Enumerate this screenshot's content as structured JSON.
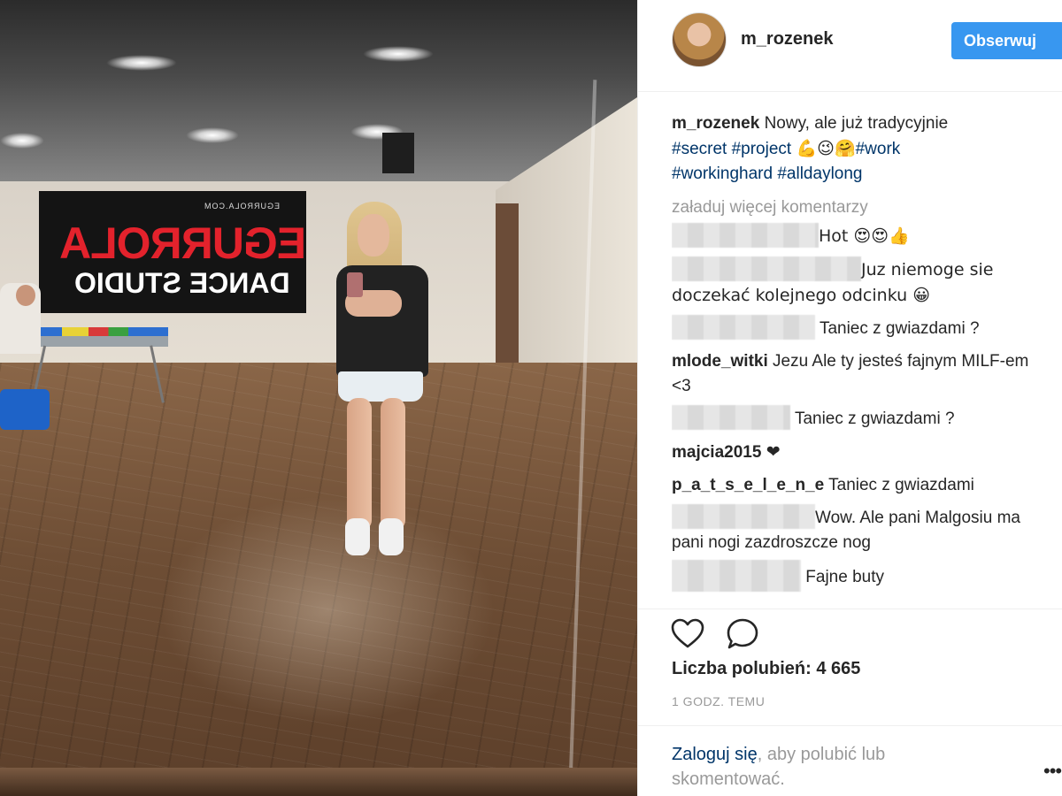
{
  "post": {
    "banner": {
      "small_text": "EGURROLA.COM",
      "big_text": "EGURROLA",
      "line2_text": "DANCE STUDIO"
    }
  },
  "header": {
    "username": "m_rozenek",
    "follow_label": "Obserwuj"
  },
  "caption": {
    "username": "m_rozenek",
    "text": "Nowy, ale już tradycyjnie",
    "tags_line1": [
      "#secret",
      "#project"
    ],
    "emojis": "💪😉🤗",
    "tag_work": "#work",
    "tags_line2": [
      "#workinghard",
      "#alldaylong"
    ]
  },
  "load_more_label": "załaduj więcej komentarzy",
  "comments": [
    {
      "username": "",
      "blurred": true,
      "text": "Hot 😍😍👍"
    },
    {
      "username": "",
      "blurred": true,
      "text": "Juz niemoge sie doczekać kolejnego odcinku 😀"
    },
    {
      "username": "",
      "blurred": true,
      "text": "Taniec z gwiazdami ?"
    },
    {
      "username": "mlode_witki",
      "blurred": false,
      "text": "Jezu Ale ty jesteś fajnym MILF-em <3"
    },
    {
      "username": "",
      "blurred": true,
      "text": "Taniec z gwiazdami ?"
    },
    {
      "username": "majcia2015",
      "blurred": false,
      "text": "❤"
    },
    {
      "username": "p_a_t_s_e_l_e_n_e",
      "blurred": false,
      "text": "Taniec z gwiazdami"
    },
    {
      "username": "",
      "blurred": true,
      "text": "Wow. Ale pani Malgosiu ma pani nogi zazdroszcze nog"
    },
    {
      "username": "",
      "blurred": true,
      "text": "Fajne buty"
    }
  ],
  "actions": {
    "like_icon": "heart-icon",
    "comment_icon": "comment-icon",
    "likes_text": "Liczba polubień: 4 665",
    "time_text": "1 GODZ. TEMU"
  },
  "login": {
    "link_label": "Zaloguj się",
    "rest_text": ", aby polubić lub skomentować.",
    "more_icon": "more-icon"
  }
}
